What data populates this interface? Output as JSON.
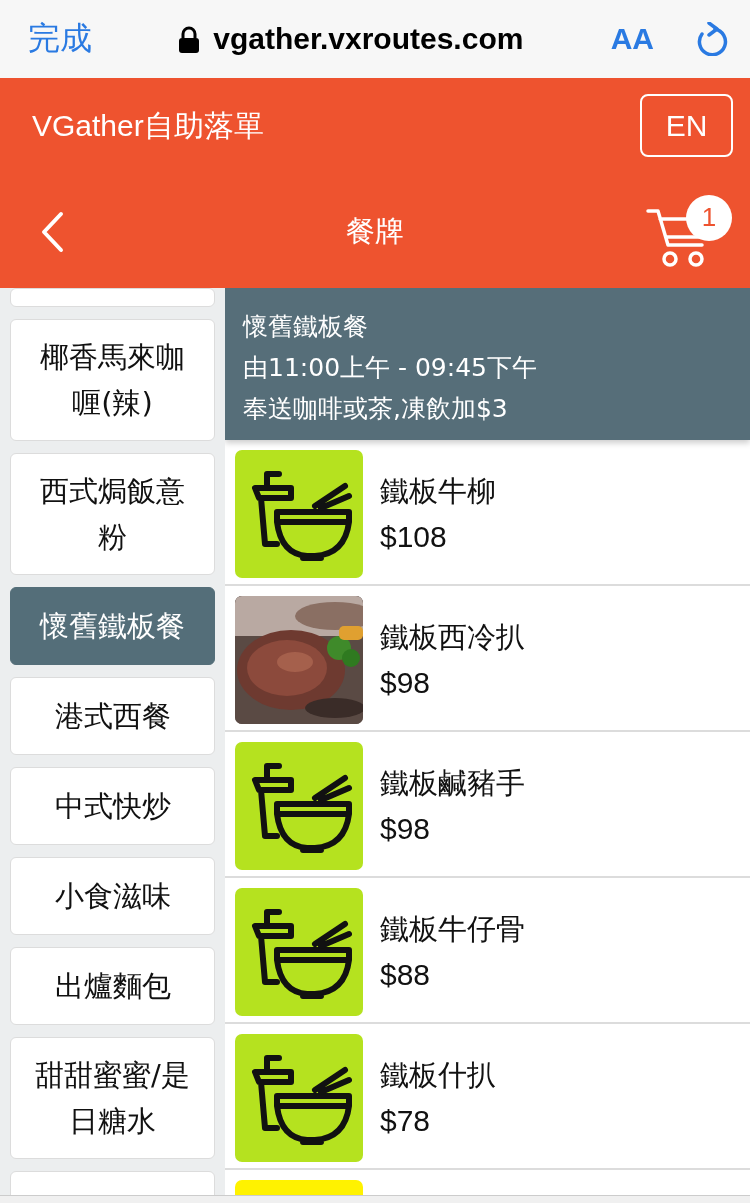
{
  "browser": {
    "done": "完成",
    "url": "vgather.vxroutes.com",
    "text_size": "AA"
  },
  "header": {
    "title": "VGather自助落單",
    "language_button": "EN"
  },
  "nav": {
    "title": "餐牌",
    "cart_count": "1"
  },
  "categories": [
    {
      "label": "椰香馬來咖喱(辣)",
      "selected": false
    },
    {
      "label": "西式焗飯意粉",
      "selected": false
    },
    {
      "label": "懷舊鐵板餐",
      "selected": true
    },
    {
      "label": "港式西餐",
      "selected": false
    },
    {
      "label": "中式快炒",
      "selected": false
    },
    {
      "label": "小食滋味",
      "selected": false
    },
    {
      "label": "出爐麵包",
      "selected": false
    },
    {
      "label": "甜甜蜜蜜/是日糖水",
      "selected": false
    }
  ],
  "banner": {
    "title": "懷舊鐵板餐",
    "hours": "由11:00上午 - 09:45下午",
    "note": "奉送咖啡或茶,凍飲加$3"
  },
  "menu_items": [
    {
      "kind": "icon",
      "color": "#b5e21f",
      "name": "鐵板牛柳",
      "price": "$108"
    },
    {
      "kind": "picture",
      "name": "鐵板西冷扒",
      "price": "$98"
    },
    {
      "kind": "icon",
      "color": "#b5e21f",
      "name": "鐵板鹹豬手",
      "price": "$98"
    },
    {
      "kind": "icon",
      "color": "#b5e21f",
      "name": "鐵板牛仔骨",
      "price": "$88"
    },
    {
      "kind": "icon",
      "color": "#b5e21f",
      "name": "鐵板什扒",
      "price": "$78"
    },
    {
      "kind": "icon",
      "color": "#fff200"
    }
  ]
}
